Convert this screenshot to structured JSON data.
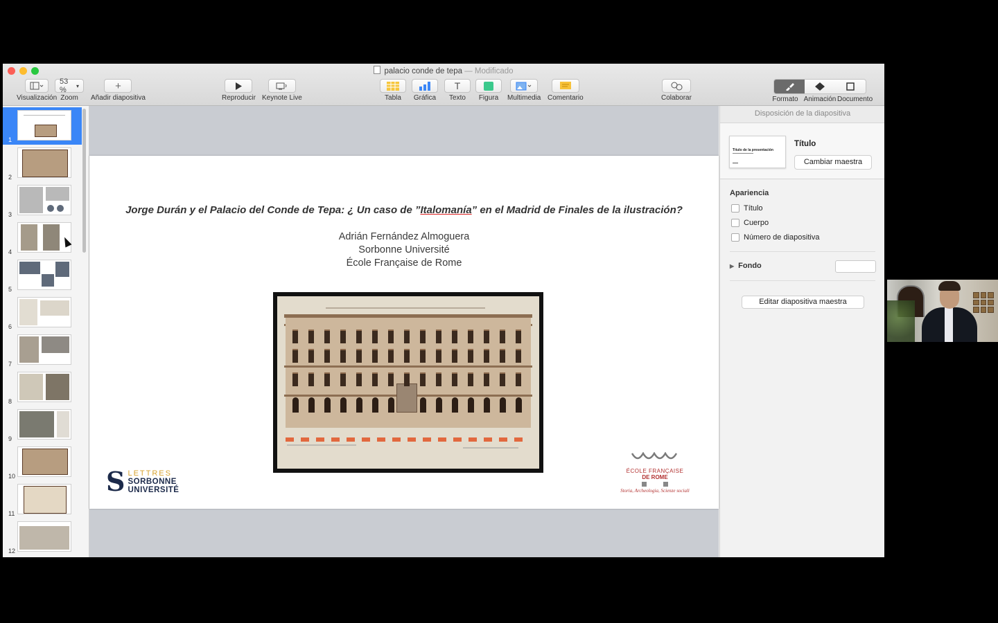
{
  "window": {
    "title": "palacio conde de tepa",
    "separator": "—",
    "status": "Modificado"
  },
  "toolbar": {
    "view_label": "Visualización",
    "zoom_value": "53 %",
    "zoom_label": "Zoom",
    "add_slide_label": "Añadir diapositiva",
    "play_label": "Reproducir",
    "keynote_live_label": "Keynote Live",
    "table_label": "Tabla",
    "chart_label": "Gráfica",
    "text_label": "Texto",
    "shape_label": "Figura",
    "media_label": "Multimedia",
    "comment_label": "Comentario",
    "collaborate_label": "Colaborar",
    "format_label": "Formato",
    "animate_label": "Animación",
    "document_label": "Documento",
    "text_glyph": "T",
    "add_glyph": "+"
  },
  "navigator": {
    "slides": [
      "1",
      "2",
      "3",
      "4",
      "5",
      "6",
      "7",
      "8",
      "9",
      "10",
      "11",
      "12"
    ],
    "selected": "1"
  },
  "slide": {
    "title_part1": "Jorge Durán y el Palacio del Conde de Tepa: ¿ Un caso de  ”",
    "title_em": "Italomanía",
    "title_part2": "” en el Madrid de Finales de la ilustración?",
    "author": "Adrián Fernández Almoguera",
    "affiliation1": "Sorbonne Université",
    "affiliation2": "École Française de Rome",
    "logo_left": {
      "mark": "S",
      "line1": "LETTRES",
      "line2": "SORBONNE",
      "line3": "UNIVERSITÉ"
    },
    "logo_right": {
      "line1": "ÉCOLE FRANÇAISE",
      "line2": "DE ROME",
      "line3": "Storia, Archeologia, Scienze sociali"
    }
  },
  "inspector": {
    "header": "Disposición de la diapositiva",
    "master_name": "Título",
    "master_thumb_text": "Título de la presentación",
    "change_master": "Cambiar maestra",
    "appearance_label": "Apariencia",
    "checkboxes": [
      "Título",
      "Cuerpo",
      "Número de diapositiva"
    ],
    "background_label": "Fondo",
    "edit_master": "Editar diapositiva maestra"
  },
  "colors": {
    "selection": "#3a86f7",
    "canvas": "#c9ccd2",
    "title_underline": "#dd2222",
    "sorbonne_gold": "#d8a331",
    "sorbonne_navy": "#1c2a4a",
    "efr_red": "#b2302f"
  }
}
